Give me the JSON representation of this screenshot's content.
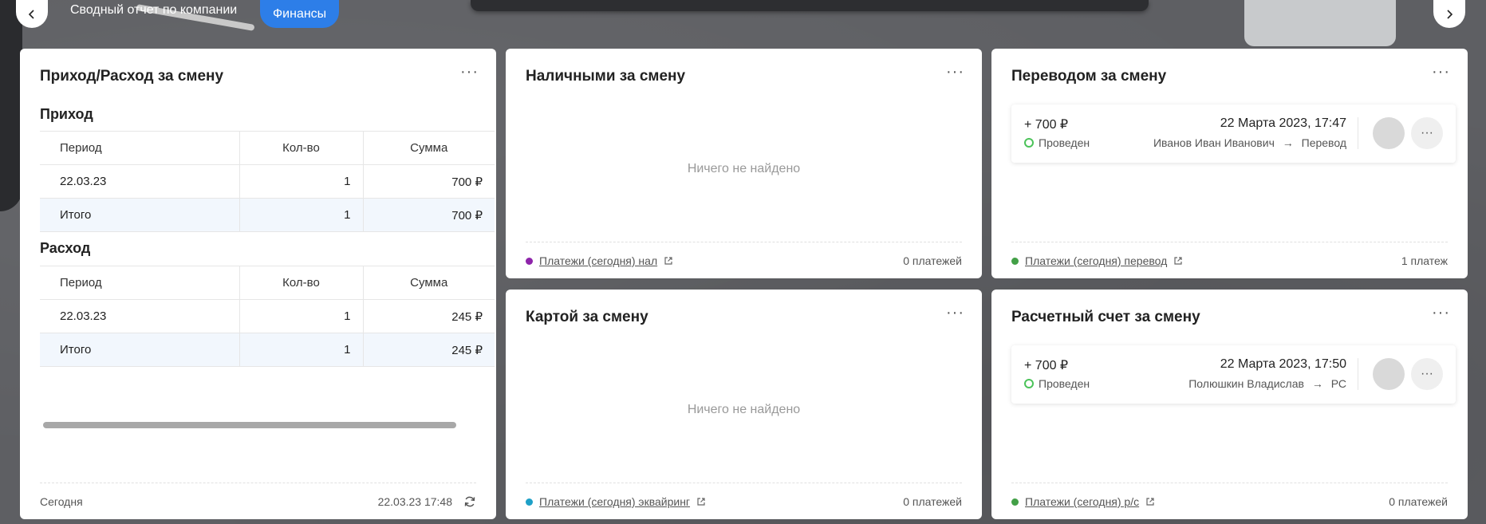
{
  "nav": {
    "breadcrumb": "Сводный отчет по компании",
    "active_tab": "Финансы"
  },
  "income_expense_card": {
    "title": "Приход/Расход за смену",
    "menu": "···",
    "income": {
      "heading": "Приход",
      "columns": [
        "Период",
        "Кол-во",
        "Сумма"
      ],
      "rows": [
        [
          "22.03.23",
          "1",
          "700 ₽"
        ]
      ],
      "total": [
        "Итого",
        "1",
        "700 ₽"
      ]
    },
    "expense": {
      "heading": "Расход",
      "columns": [
        "Период",
        "Кол-во",
        "Сумма"
      ],
      "rows": [
        [
          "22.03.23",
          "1",
          "245 ₽"
        ]
      ],
      "total": [
        "Итого",
        "1",
        "245 ₽"
      ]
    },
    "footer": {
      "period": "Сегодня",
      "timestamp": "22.03.23 17:48"
    }
  },
  "cash_card": {
    "title": "Наличными за смену",
    "menu": "···",
    "empty_text": "Ничего не найдено",
    "footer_link": "Платежи (сегодня) нал",
    "footer_count": "0 платежей",
    "dot_color": "#8e24aa"
  },
  "card_card": {
    "title": "Картой за смену",
    "menu": "···",
    "empty_text": "Ничего не найдено",
    "footer_link": "Платежи (сегодня) эквайринг",
    "footer_count": "0 платежей",
    "dot_color": "#1ea0c7"
  },
  "transfer_card": {
    "title": "Переводом за смену",
    "menu": "···",
    "payment": {
      "amount": "+ 700 ₽",
      "status": "Проведен",
      "date": "22 Марта 2023, 17:47",
      "from": "Иванов Иван Иванович",
      "arrow": "→",
      "to": "Перевод",
      "more": "···"
    },
    "footer_link": "Платежи (сегодня) перевод",
    "footer_count": "1 платеж",
    "dot_color": "#43a047"
  },
  "account_card": {
    "title": "Расчетный счет за смену",
    "menu": "···",
    "payment": {
      "amount": "+ 700 ₽",
      "status": "Проведен",
      "date": "22 Марта 2023, 17:50",
      "from": "Полюшкин Владислав",
      "arrow": "→",
      "to": "РС",
      "more": "···"
    },
    "footer_link": "Платежи (сегодня) р/с",
    "footer_count": "0 платежей",
    "dot_color": "#43a047"
  },
  "colors": {
    "accent": "#2d7ee8",
    "status_ok": "#4cc35a",
    "total_row_bg": "#f2f7fd"
  }
}
